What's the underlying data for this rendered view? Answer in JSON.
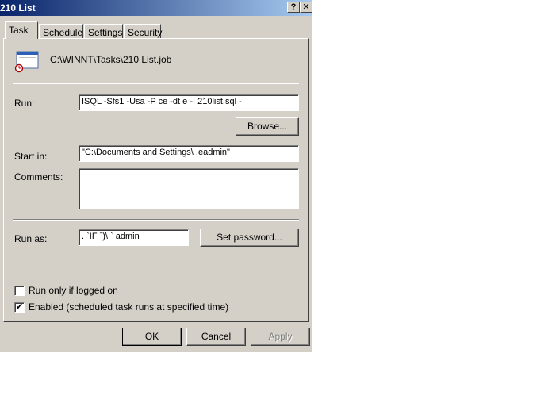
{
  "window": {
    "title": "210 List",
    "help_glyph": "?",
    "close_glyph": "✕"
  },
  "tabs": [
    {
      "label": "Task",
      "active": true
    },
    {
      "label": "Schedule",
      "active": false
    },
    {
      "label": "Settings",
      "active": false
    },
    {
      "label": "Security",
      "active": false
    }
  ],
  "task": {
    "path": "C:\\WINNT\\Tasks\\210 List.job",
    "run_label": "Run:",
    "run_value": "ISQL -Sfs1 -Usa -P            ce -dt         e -I 210list.sql -",
    "browse_label": "Browse...",
    "startin_label": "Start in:",
    "startin_value": "\"C:\\Documents and Settings\\   .eadmin\"",
    "comments_label": "Comments:",
    "comments_value": "",
    "runas_label": "Run as:",
    "runas_value": ".  `IF  ˉ)\\  `    admin",
    "setpassword_label": "Set password...",
    "run_only_logged_on_label": "Run only if logged on",
    "run_only_logged_on_checked": false,
    "enabled_label": "Enabled (scheduled task runs at specified time)",
    "enabled_checked": true,
    "check_glyph": "✔"
  },
  "footer": {
    "ok_label": "OK",
    "cancel_label": "Cancel",
    "apply_label": "Apply"
  }
}
